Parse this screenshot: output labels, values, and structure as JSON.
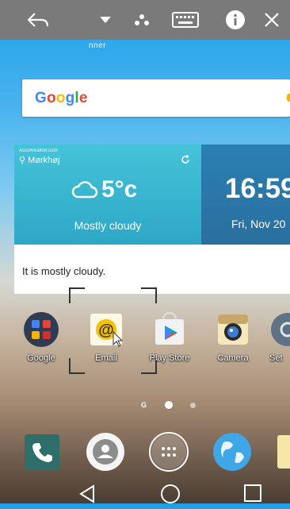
{
  "toolbar": {
    "icons": [
      "back-arrow-icon",
      "dropdown-icon",
      "share-icon",
      "keyboard-icon",
      "info-icon",
      "close-icon"
    ]
  },
  "ghost_text": "nner",
  "google": {
    "logo_text": [
      "G",
      "o",
      "o",
      "g",
      "l",
      "e"
    ]
  },
  "weather": {
    "source": "AccuWeather.com",
    "location": "Mørkhøj",
    "temperature": "5°c",
    "condition": "Mostly cloudy",
    "summary": "It is mostly cloudy."
  },
  "clock": {
    "time": "16:59",
    "date": "Fri, Nov 20"
  },
  "apps": [
    {
      "label": "Google",
      "icon": "google-folder-icon"
    },
    {
      "label": "Email",
      "icon": "email-icon"
    },
    {
      "label": "Play Store",
      "icon": "play-store-icon"
    },
    {
      "label": "Camera",
      "icon": "camera-icon"
    },
    {
      "label": "Set",
      "icon": "settings-icon"
    }
  ],
  "page_indicator": {
    "label": "G",
    "pages": 2,
    "active": 1
  },
  "dock": [
    "phone-icon",
    "contacts-icon",
    "apps-grid-icon",
    "browser-globe-icon",
    "memo-icon"
  ],
  "nav": [
    "back-icon",
    "home-icon",
    "recents-icon"
  ],
  "colors": {
    "toolbar": "#7a7a7a",
    "weather_bg": "#45c3d9",
    "clock_bg": "#2a7fb3"
  }
}
